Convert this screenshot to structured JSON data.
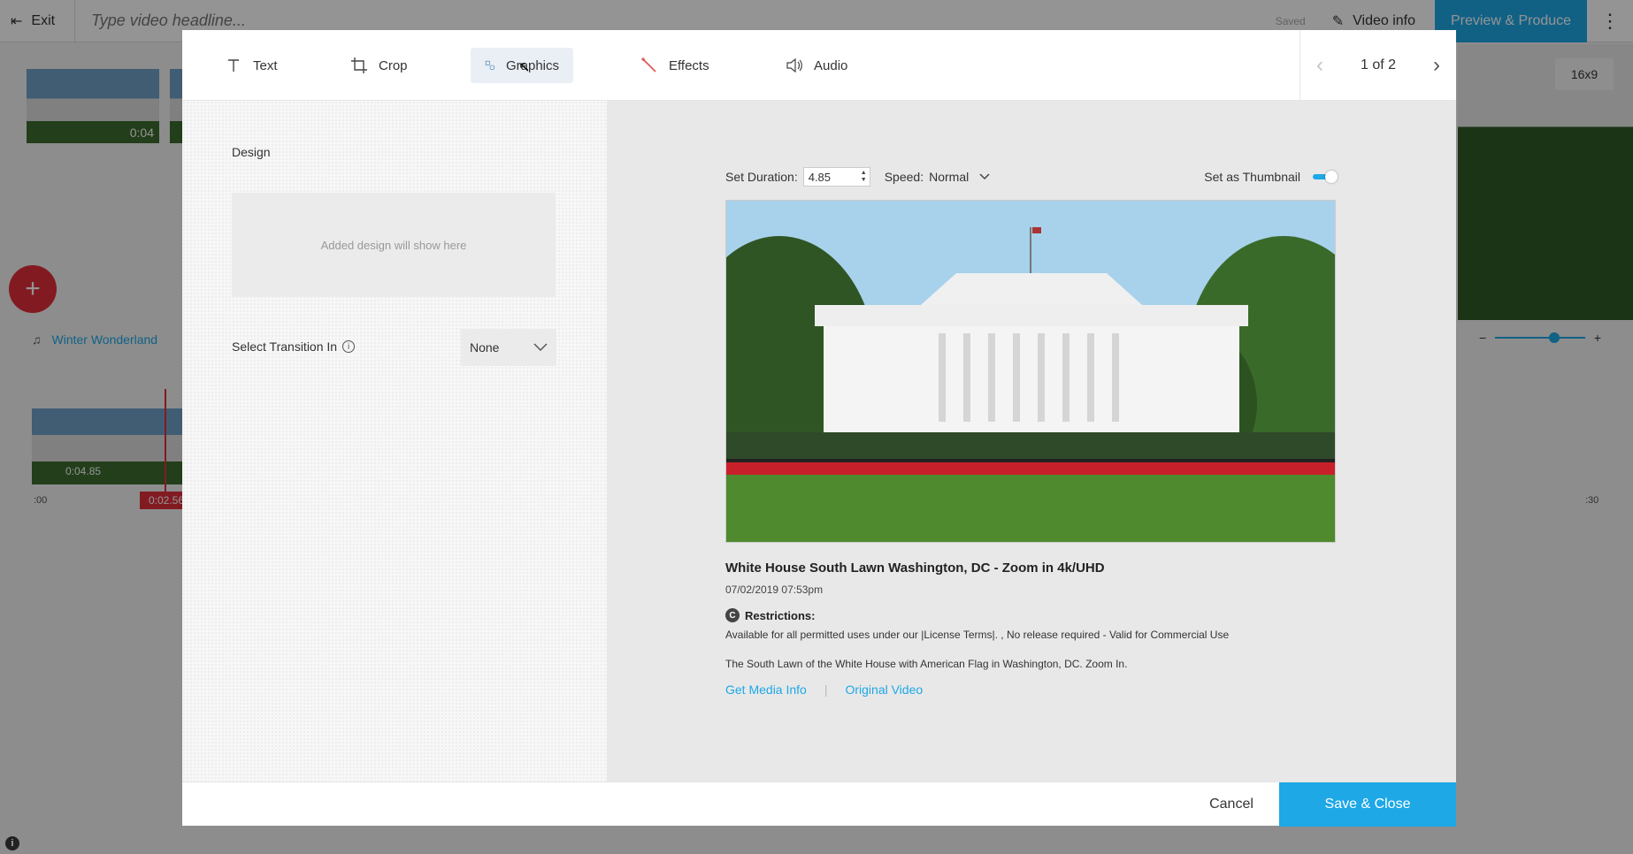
{
  "topbar": {
    "exit_label": "Exit",
    "headline_placeholder": "Type video headline...",
    "saved_label": "Saved",
    "video_info_label": "Video info",
    "produce_label": "Preview & Produce"
  },
  "background": {
    "thumb_time": "0:04",
    "music_track": "Winter Wonderland",
    "clip_duration": "0:04.85",
    "playhead_time": "0:02.56",
    "tick_start": ":00",
    "tick_end": ":30",
    "ratio": "16x9"
  },
  "tabs": [
    {
      "label": "Text",
      "icon": "text-icon"
    },
    {
      "label": "Crop",
      "icon": "crop-icon"
    },
    {
      "label": "Graphics",
      "icon": "graphics-icon",
      "active": true
    },
    {
      "label": "Effects",
      "icon": "magic-wand-icon"
    },
    {
      "label": "Audio",
      "icon": "speaker-icon"
    }
  ],
  "pager": {
    "label": "1 of 2"
  },
  "design": {
    "label": "Design",
    "placeholder": "Added design will show here"
  },
  "transition": {
    "label": "Select Transition In",
    "value": "None"
  },
  "controls": {
    "duration_label": "Set Duration:",
    "duration_value": "4.85",
    "speed_label": "Speed:",
    "speed_value": "Normal",
    "thumbnail_label": "Set as Thumbnail",
    "thumbnail_on": true
  },
  "media": {
    "title": "White House South Lawn Washington, DC - Zoom in 4k/UHD",
    "date": "07/02/2019 07:53pm",
    "restrictions_label": "Restrictions:",
    "restrictions_text": "Available for all permitted uses under our |License Terms|. , No release required - Valid for Commercial Use",
    "description": "The South Lawn of the White House with American Flag in Washington, DC. Zoom In.",
    "link_info": "Get Media Info",
    "link_original": "Original Video"
  },
  "footer": {
    "cancel_label": "Cancel",
    "save_label": "Save & Close"
  },
  "colors": {
    "accent": "#1ea8e6",
    "record": "#e0303a"
  }
}
